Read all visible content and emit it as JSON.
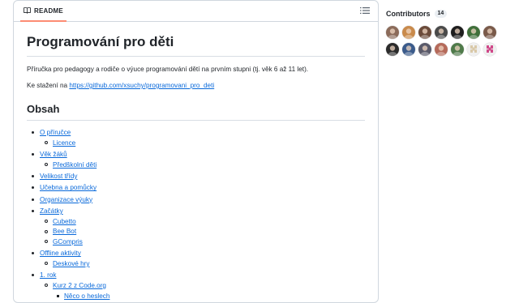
{
  "readme": {
    "tab_label": "README",
    "title": "Programování pro děti",
    "description": "Příručka pro pedagogy a rodiče o výuce programování dětí na prvním stupni (tj. věk 6 až 11 let).",
    "download_prefix": "Ke stažení na ",
    "download_link": "https://github.com/xsuchy/programovani_pro_deti",
    "toc_heading": "Obsah",
    "toc": [
      {
        "label": "O příručce",
        "children": [
          {
            "label": "Licence"
          }
        ]
      },
      {
        "label": "Věk žáků",
        "children": [
          {
            "label": "Předškolní děti"
          }
        ]
      },
      {
        "label": "Velikost třídy",
        "children": []
      },
      {
        "label": "Učebna a pomůcky",
        "children": []
      },
      {
        "label": "Organizace výuky",
        "children": []
      },
      {
        "label": "Začátky",
        "children": [
          {
            "label": "Cubetto"
          },
          {
            "label": "Bee Bot"
          },
          {
            "label": "GCompris"
          }
        ]
      },
      {
        "label": "Offline aktivity",
        "children": [
          {
            "label": "Deskové hry"
          }
        ]
      },
      {
        "label": "1. rok",
        "children": [
          {
            "label": "Kurz 2 z Code.org",
            "children": [
              {
                "label": "Něco o heslech"
              }
            ]
          }
        ]
      }
    ]
  },
  "sidebar": {
    "contributors_label": "Contributors",
    "contributors_count": "14",
    "avatars": [
      {
        "icon": "avatar-photo",
        "color": "#8b6b5a"
      },
      {
        "icon": "avatar-photo",
        "color": "#c98a4b"
      },
      {
        "icon": "avatar-photo",
        "color": "#6b4b3a"
      },
      {
        "icon": "avatar-photo",
        "color": "#4a4a4a"
      },
      {
        "icon": "avatar-photo",
        "color": "#1e1e1e"
      },
      {
        "icon": "avatar-photo",
        "color": "#3f6f3a"
      },
      {
        "icon": "avatar-photo",
        "color": "#7a5a4a"
      },
      {
        "icon": "avatar-photo",
        "color": "#2b2b2b"
      },
      {
        "icon": "avatar-photo",
        "color": "#3b5b8b"
      },
      {
        "icon": "avatar-photo",
        "color": "#5a5a6a"
      },
      {
        "icon": "avatar-photo",
        "color": "#b56a5a"
      },
      {
        "icon": "avatar-photo",
        "color": "#4f7a4a"
      },
      {
        "icon": "avatar-identicon",
        "color": "#d9c9a9"
      },
      {
        "icon": "avatar-identicon",
        "color": "#d04a8a"
      }
    ]
  }
}
